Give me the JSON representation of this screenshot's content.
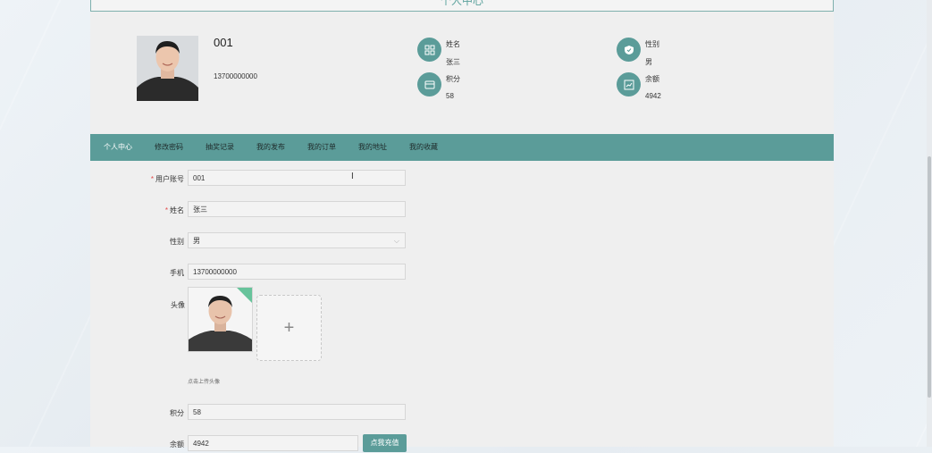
{
  "header": {
    "title": "个人中心"
  },
  "profile": {
    "id": "001",
    "phone": "13700000000"
  },
  "stats": [
    {
      "label": "姓名",
      "value": "张三",
      "icon": "grid-icon"
    },
    {
      "label": "性别",
      "value": "男",
      "icon": "shield-icon"
    },
    {
      "label": "积分",
      "value": "58",
      "icon": "wallet-icon"
    },
    {
      "label": "余额",
      "value": "4942",
      "icon": "chart-icon"
    }
  ],
  "nav": [
    "个人中心",
    "修改密码",
    "抽奖记录",
    "我的发布",
    "我的订单",
    "我的地址",
    "我的收藏"
  ],
  "form": {
    "account_label": "用户账号",
    "account_value": "001",
    "name_label": "姓名",
    "name_value": "张三",
    "gender_label": "性别",
    "gender_value": "男",
    "phone_label": "手机",
    "phone_value": "13700000000",
    "avatar_label": "头像",
    "upload_plus": "+",
    "upload_hint": "点击上传头像",
    "points_label": "积分",
    "points_value": "58",
    "balance_label": "余额",
    "balance_value": "4942",
    "recharge_label": "点我充值"
  },
  "colors": {
    "accent": "#5b9c99",
    "required": "#e24a4a"
  }
}
